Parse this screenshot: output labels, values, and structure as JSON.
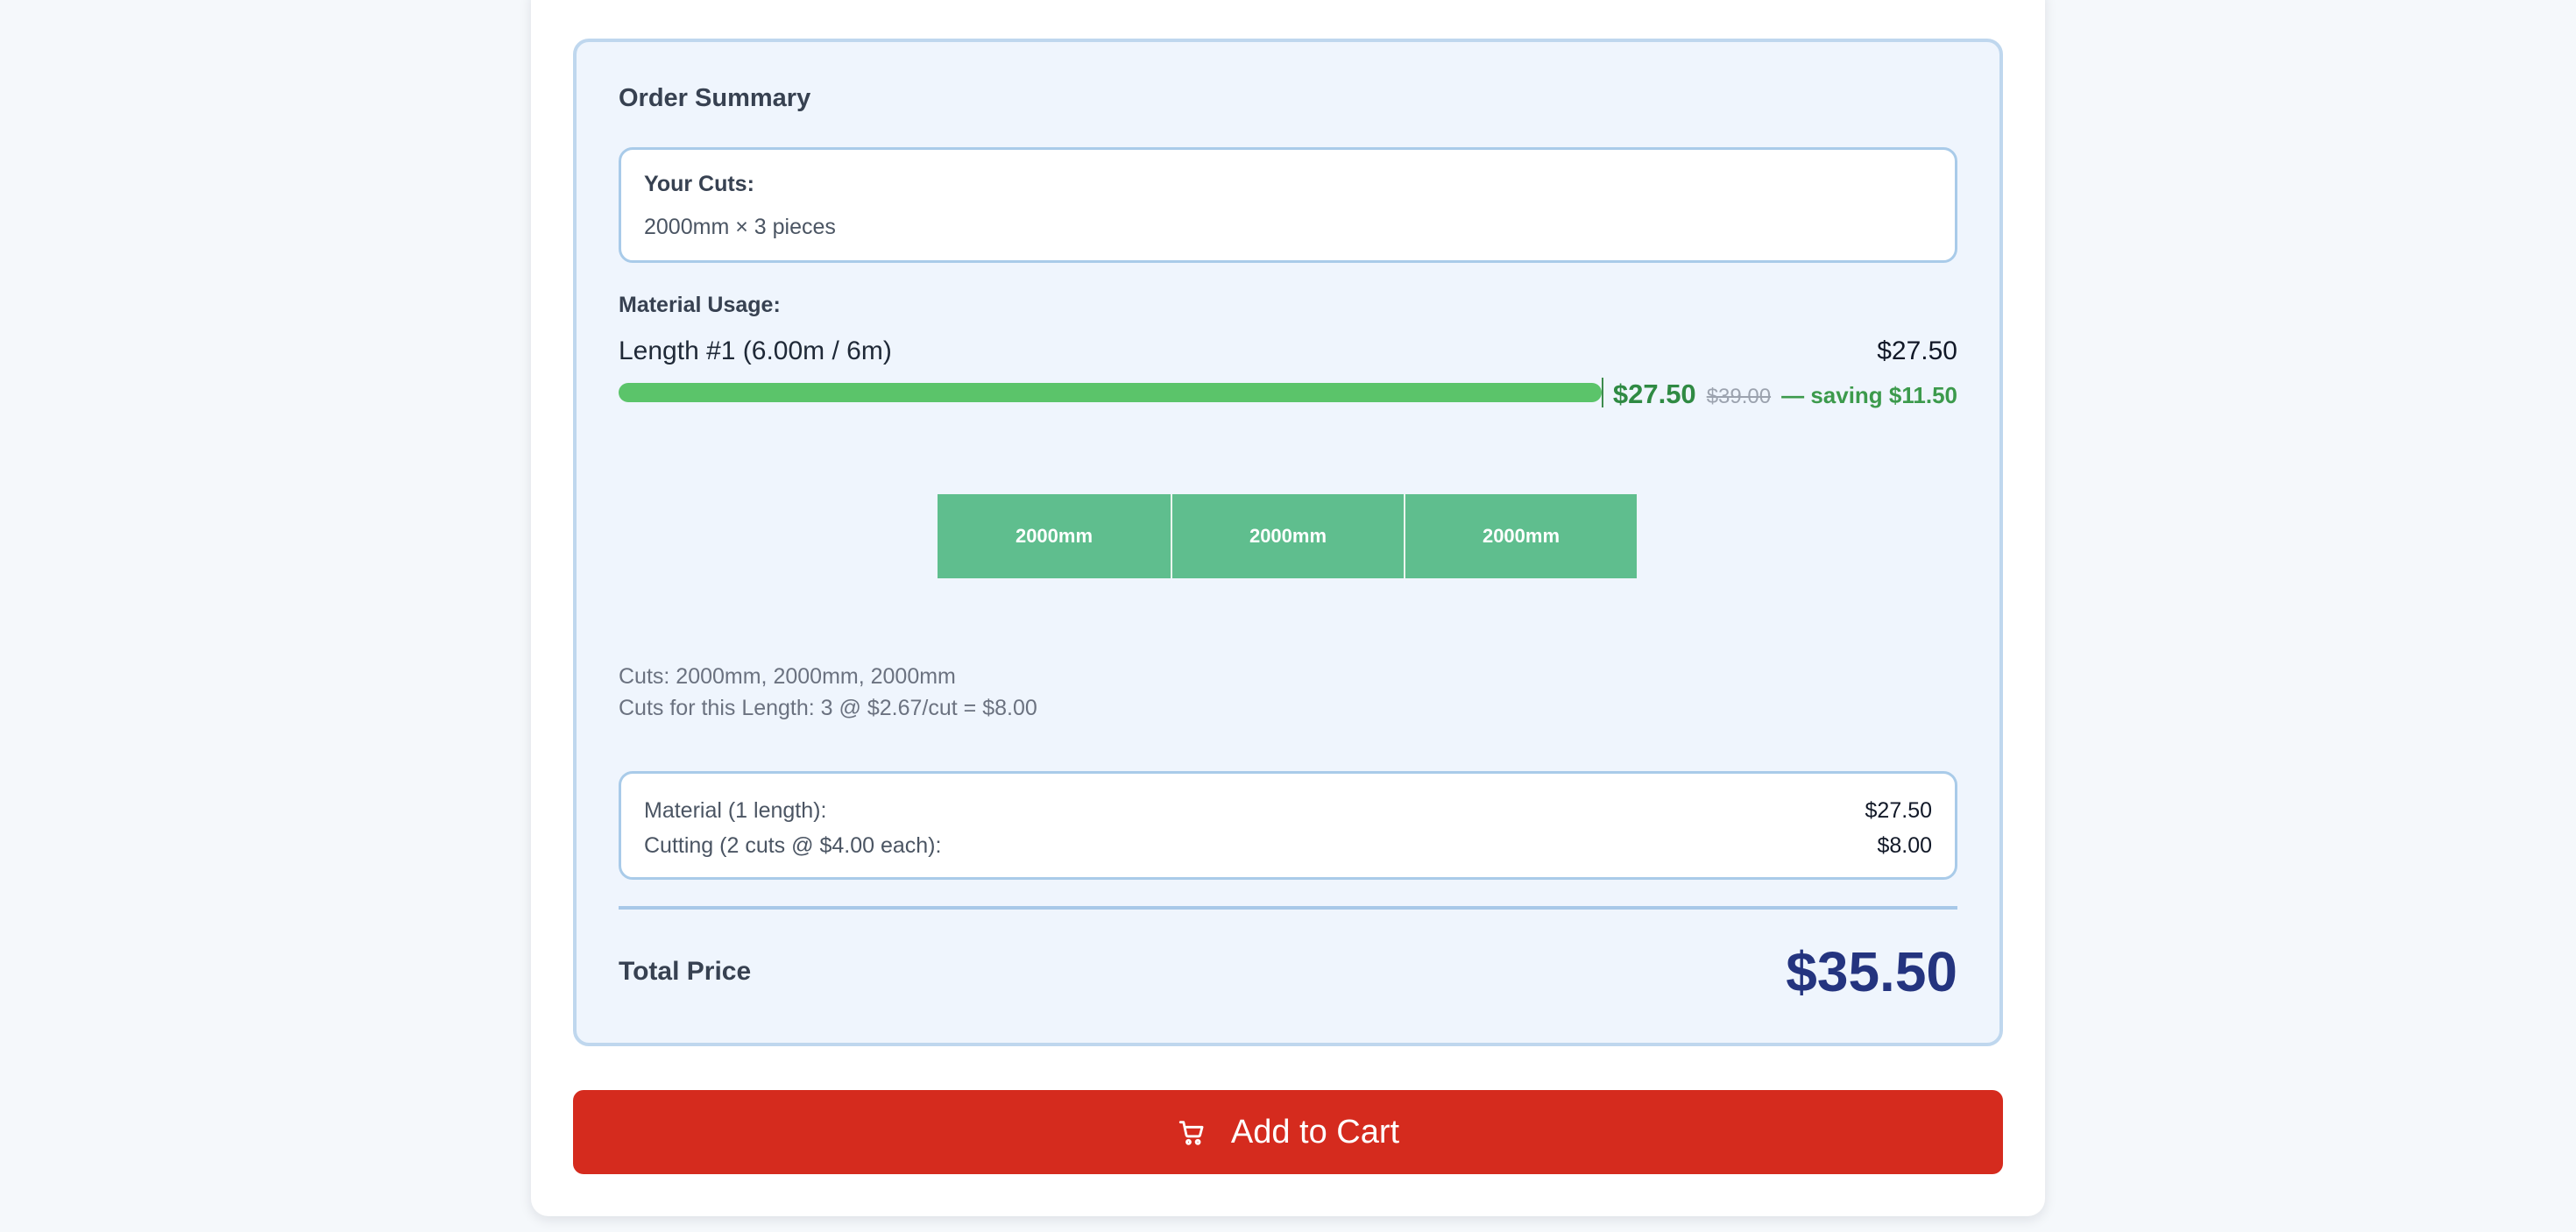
{
  "summary": {
    "title": "Order Summary",
    "your_cuts": {
      "title": "Your Cuts:",
      "text": "2000mm × 3 pieces"
    },
    "material_usage": {
      "label": "Material Usage:",
      "length_label": "Length #1 (6.00m / 6m)",
      "length_price": "$27.50",
      "usage_fraction": 1.0,
      "sale_price": "$27.50",
      "original_price": "$39.00",
      "saving_text": "— saving $11.50"
    },
    "cut_segments": [
      "2000mm",
      "2000mm",
      "2000mm"
    ],
    "cuts_list": "Cuts: 2000mm, 2000mm, 2000mm",
    "cuts_cost": "Cuts for this Length: 3 @ $2.67/cut = $8.00",
    "breakdown": [
      {
        "label": "Material (1 length):",
        "value": "$27.50"
      },
      {
        "label": "Cutting (2 cuts @ $4.00 each):",
        "value": "$8.00"
      }
    ],
    "total": {
      "label": "Total Price",
      "value": "$35.50"
    }
  },
  "cart_button": {
    "label": "Add to Cart",
    "icon": "cart-icon"
  },
  "colors": {
    "accent_red": "#d52b1e",
    "usage_green": "#5bc46a",
    "segment_green": "#5fbe8e",
    "total_blue": "#24347f"
  }
}
